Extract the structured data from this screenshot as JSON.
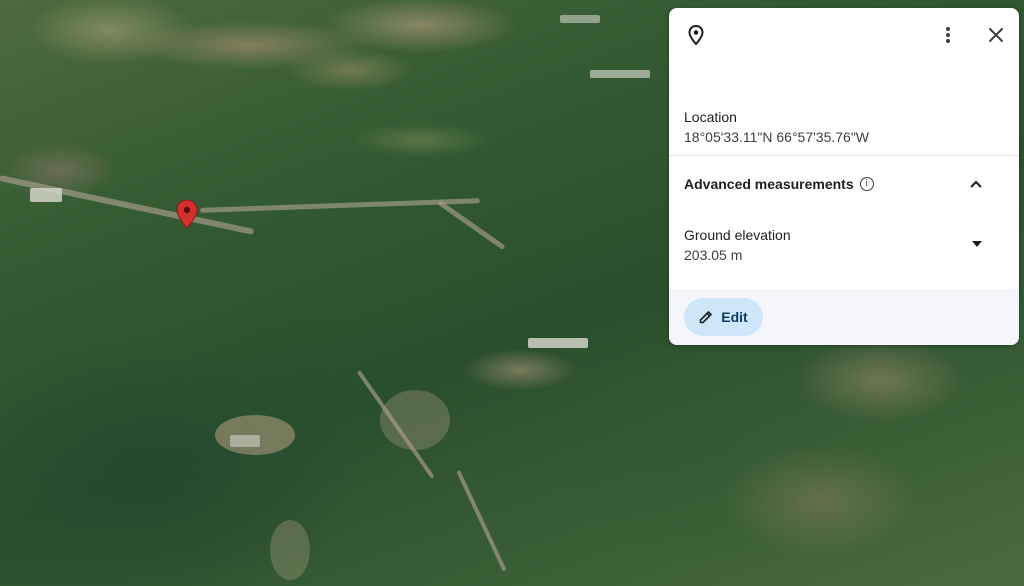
{
  "map": {
    "marker": "map-pin-icon"
  },
  "panel": {
    "icons": {
      "place": "location-pin-icon",
      "more": "more-vert-icon",
      "close": "close-icon",
      "info": "info-icon",
      "collapse": "chevron-up-icon",
      "expand": "dropdown-arrow-icon",
      "edit": "pencil-icon"
    },
    "location_label": "Location",
    "location_value": "18°05'33.11\"N 66°57'35.76\"W",
    "advanced_label": "Advanced measurements",
    "ground_label": "Ground elevation",
    "ground_value": "203.05 m",
    "edit_label": "Edit",
    "colors": {
      "pin": "#d32f2f",
      "edit_bg": "#cde6f9",
      "edit_text": "#0b3d66"
    }
  }
}
